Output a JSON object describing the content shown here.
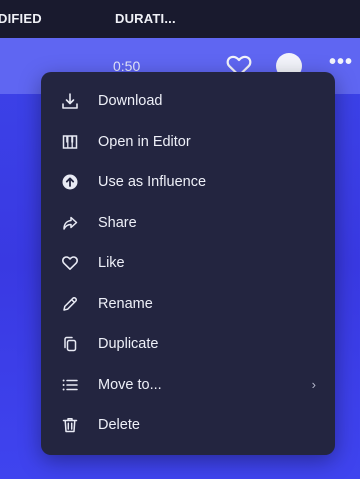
{
  "header": {
    "col_modified": "DIFIED",
    "col_duration": "DURATI..."
  },
  "track_row": {
    "duration": "0:50",
    "more": "•••"
  },
  "menu": {
    "items": [
      {
        "label": "Download",
        "icon": "download-icon"
      },
      {
        "label": "Open in Editor",
        "icon": "piano-keys-icon"
      },
      {
        "label": "Use as Influence",
        "icon": "arrow-up-circle-icon"
      },
      {
        "label": "Share",
        "icon": "share-arrow-icon"
      },
      {
        "label": "Like",
        "icon": "heart-icon"
      },
      {
        "label": "Rename",
        "icon": "pencil-icon"
      },
      {
        "label": "Duplicate",
        "icon": "duplicate-icon"
      },
      {
        "label": "Move to...",
        "icon": "list-icon",
        "chevron": "›"
      },
      {
        "label": "Delete",
        "icon": "trash-icon"
      }
    ]
  }
}
